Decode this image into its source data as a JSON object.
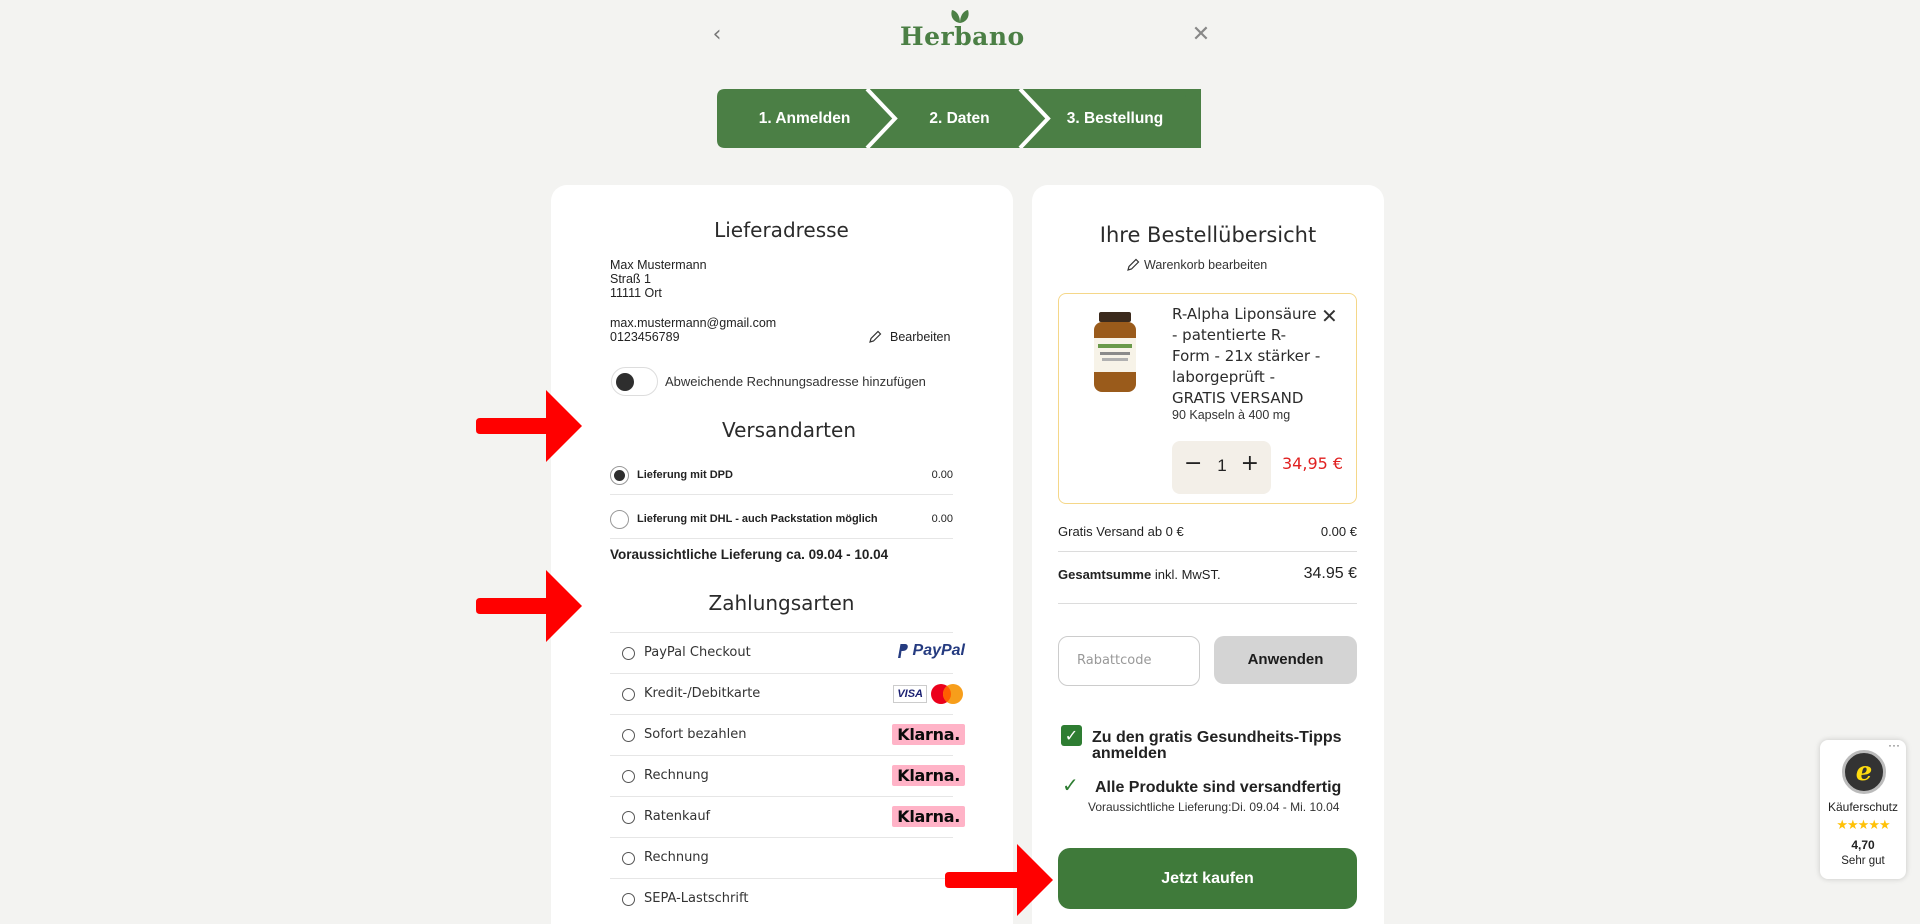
{
  "header": {
    "back_icon": "chevron-left-icon",
    "close_icon": "close-icon",
    "logo_text": "Herbano"
  },
  "steps": [
    "1. Anmelden",
    "2. Daten",
    "3. Bestellung"
  ],
  "colors": {
    "brand_green": "#4b7f45",
    "button_green": "#3f7a3a",
    "price_red": "#e02020",
    "klarna_pink": "#ffb3c7",
    "arrow_red": "#ff0000"
  },
  "shipping_address": {
    "title": "Lieferadresse",
    "name": "Max Mustermann",
    "street": "Straß 1",
    "city": "11111 Ort",
    "email": "max.mustermann@gmail.com",
    "phone": "0123456789",
    "edit_label": "Bearbeiten",
    "toggle_label": "Abweichende Rechnungsadresse hinzufügen"
  },
  "shipping": {
    "title": "Versandarten",
    "options": [
      {
        "label": "Lieferung mit DPD",
        "price": "0.00",
        "selected": true
      },
      {
        "label": "Lieferung mit DHL - auch Packstation möglich",
        "price": "0.00",
        "selected": false
      }
    ],
    "delivery_label": "Voraussichtliche Lieferung",
    "delivery_range": "ca. 09.04 - 10.04"
  },
  "payment": {
    "title": "Zahlungsarten",
    "options": [
      {
        "label": "PayPal Checkout",
        "logo": "PayPal"
      },
      {
        "label": "Kredit-/Debitkarte",
        "logo": "VISA / Mastercard"
      },
      {
        "label": "Sofort bezahlen",
        "logo": "Klarna."
      },
      {
        "label": "Rechnung",
        "logo": "Klarna."
      },
      {
        "label": "Ratenkauf",
        "logo": "Klarna."
      },
      {
        "label": "Rechnung",
        "logo": ""
      },
      {
        "label": "SEPA-Lastschrift",
        "logo": ""
      }
    ]
  },
  "summary": {
    "title": "Ihre Bestellübersicht",
    "edit_cart_label": "Warenkorb bearbeiten",
    "product": {
      "title": "R-Alpha Liponsäure - patentierte R-Form - 21x stärker - laborgeprüft - GRATIS VERSAND",
      "subtitle": "90 Kapseln à 400 mg",
      "quantity": "1",
      "price": "34,95 €",
      "minus": "−",
      "plus": "+"
    },
    "shipping_label": "Gratis Versand ab 0 €",
    "shipping_value": "0.00 €",
    "total_label": "Gesamtsumme",
    "total_suffix": "inkl. MwST.",
    "total_value": "34.95 €",
    "coupon_placeholder": "Rabattcode",
    "apply_label": "Anwenden",
    "newsletter_label": "Zu den gratis Gesundheits-Tipps anmelden",
    "newsletter_checked": true,
    "ready_label": "Alle Produkte sind versandfertig",
    "ready_sub": "Voraussichtliche Lieferung:Di. 09.04 - Mi. 10.04",
    "buy_label": "Jetzt kaufen"
  },
  "trusted_badge": {
    "label": "Käuferschutz",
    "stars": "★★★★★",
    "score": "4,70",
    "rating_text": "Sehr gut",
    "seal_letter": "e"
  }
}
